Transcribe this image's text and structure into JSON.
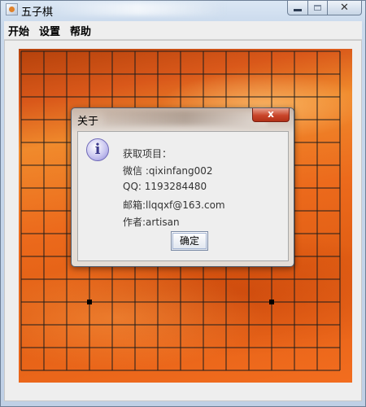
{
  "window": {
    "title": "五子棋",
    "close_glyph": "✕"
  },
  "menu": [
    "开始",
    "设置",
    "帮助"
  ],
  "dialog": {
    "title": "关于",
    "close_glyph": "x",
    "icon_glyph": "i",
    "lines": [
      "获取项目：",
      "微信 :qixinfang002",
      "QQ: 1193284480",
      "邮箱:llqqxf@163.com",
      "作者:artisan"
    ],
    "ok_label": "确定"
  },
  "board": {
    "grid_lines": 15,
    "star_points": [
      [
        3,
        11
      ],
      [
        11,
        11
      ]
    ],
    "line_color": "#1c1c1c"
  }
}
